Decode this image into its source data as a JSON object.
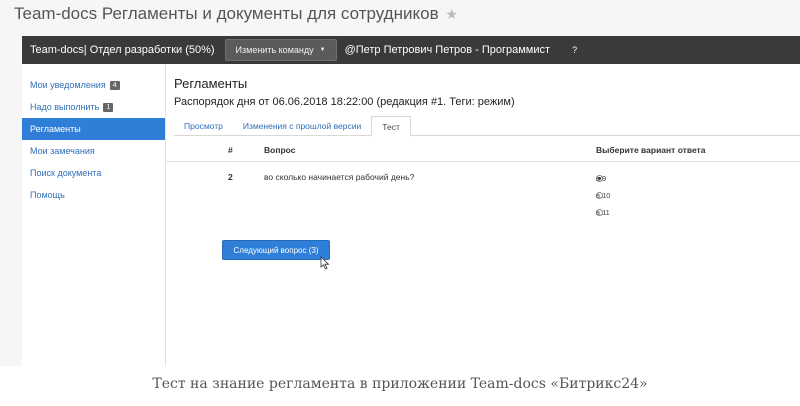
{
  "page_title": "Team-docs Регламенты и документы для сотрудников",
  "topbar": {
    "team_label": "Team-docs| Отдел разработки (50%)",
    "change_team_button": "Изменить команду",
    "user_label": "@Петр Петрович Петров - Программист",
    "help_label": "?"
  },
  "sidebar": {
    "items": [
      {
        "label": "Мои уведомления",
        "badge": "4"
      },
      {
        "label": "Надо выполнить",
        "badge": "1"
      },
      {
        "label": "Регламенты",
        "badge": ""
      },
      {
        "label": "Мои замечания",
        "badge": ""
      },
      {
        "label": "Поиск документа",
        "badge": ""
      },
      {
        "label": "Помощь",
        "badge": ""
      }
    ],
    "active_index": 2
  },
  "main": {
    "title": "Регламенты",
    "subtitle": "Распорядок дня от 06.06.2018 18:22:00 (редакция #1. Теги: режим)",
    "tabs": [
      {
        "label": "Просмотр"
      },
      {
        "label": "Изменения с прошлой версии"
      },
      {
        "label": "Тест"
      }
    ],
    "active_tab": 2,
    "table": {
      "headers": {
        "num": "#",
        "question": "Вопрос",
        "answer": "Выберите вариант ответа"
      },
      "row": {
        "num": "2",
        "question": "во сколько начинается рабочий день?",
        "options": [
          {
            "label": "в 9",
            "checked": true
          },
          {
            "label": "в 10",
            "checked": false
          },
          {
            "label": "в 11",
            "checked": false
          }
        ]
      }
    },
    "next_button": "Следующий вопрос (3)"
  },
  "caption": "Тест на знание регламента в приложении Team-docs «Битрикс24»"
}
